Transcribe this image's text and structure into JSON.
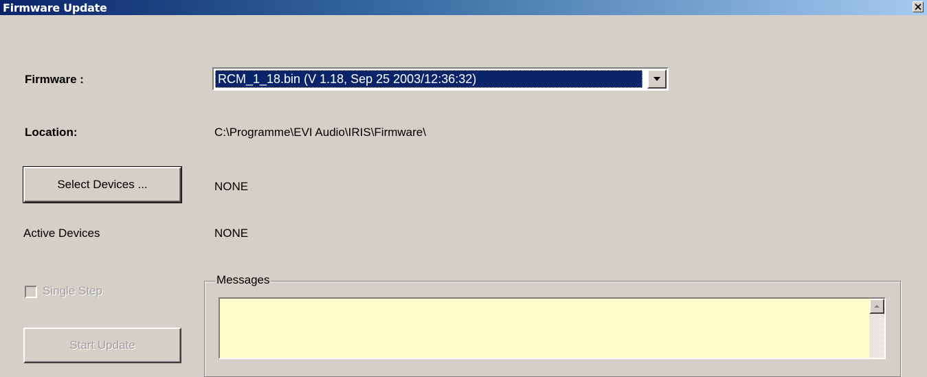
{
  "window": {
    "title": "Firmware Update",
    "close_glyph": "✕"
  },
  "firmware": {
    "label": "Firmware :",
    "selected_value": "RCM_1_18.bin (V 1.18, Sep 25 2003/12:36:32)"
  },
  "location": {
    "label": "Location:",
    "value": "C:\\Programme\\EVI Audio\\IRIS\\Firmware\\"
  },
  "devices": {
    "select_button_label": "Select Devices ...",
    "selected_value": "NONE",
    "active_label": "Active Devices",
    "active_value": "NONE"
  },
  "single_step": {
    "label": "Single Step",
    "checked": false,
    "enabled": false
  },
  "start_update": {
    "label": "Start Update",
    "enabled": false
  },
  "messages": {
    "group_label": "Messages",
    "content": ""
  },
  "colors": {
    "window_bg": "#d4d0c8",
    "titlebar_start": "#0a246a",
    "titlebar_end": "#a6caf0",
    "selection": "#0a246a",
    "messages_bg": "#ffffcc",
    "disabled_text": "#a0a0a0"
  }
}
